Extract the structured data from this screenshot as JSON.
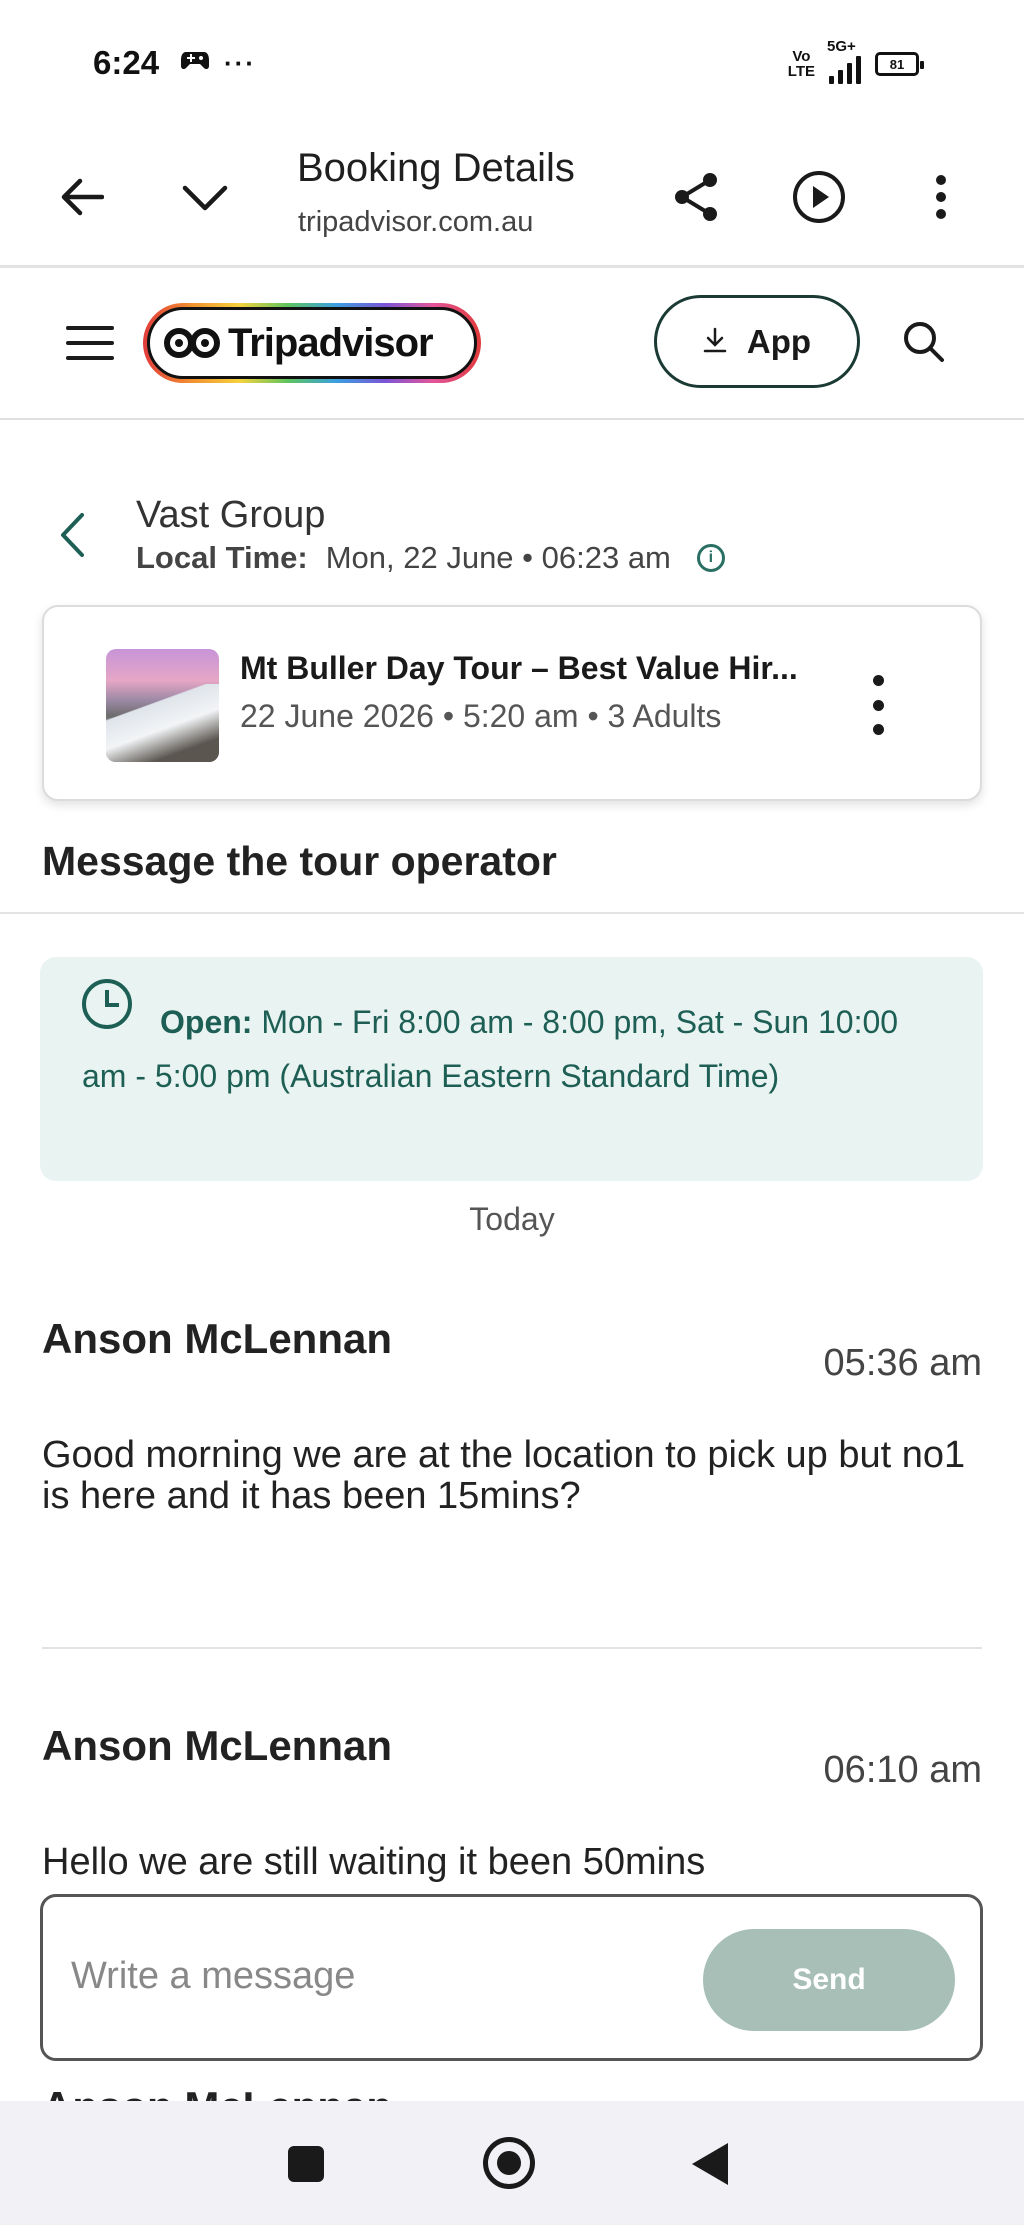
{
  "status_bar": {
    "time": "6:24",
    "more": "···",
    "network_label_top": "Vo",
    "network_label_bottom": "LTE",
    "network_type": "5G+",
    "battery": "81"
  },
  "browser": {
    "title": "Booking Details",
    "url": "tripadvisor.com.au"
  },
  "site_header": {
    "logo_text": "Tripadvisor",
    "app_button_label": "App"
  },
  "conversation": {
    "operator_name": "Vast Group",
    "local_time_label": "Local Time:",
    "local_time_value": "Mon, 22 June • 06:23 am",
    "info_glyph": "i"
  },
  "booking": {
    "title": "Mt Buller Day Tour – Best Value Hir...",
    "meta": "22 June 2026 • 5:20 am • 3 Adults"
  },
  "section_title": "Message the tour operator",
  "hours": {
    "label": "Open:",
    "text": "Mon - Fri 8:00 am - 8:00 pm, Sat - Sun 10:00 am - 5:00 pm (Australian Eastern Standard Time)"
  },
  "day_label": "Today",
  "messages": [
    {
      "sender": "Anson McLennan",
      "time": "05:36 am",
      "body": "Good morning we are at the location to pick up but no1 is here  and it has been 15mins?"
    },
    {
      "sender": "Anson McLennan",
      "time": "06:10 am",
      "body": "Hello we are still waiting it been 50mins"
    }
  ],
  "composer": {
    "placeholder": "Write a message",
    "send_label": "Send"
  },
  "peek_sender": "Anson McLennan",
  "colors": {
    "brand_green": "#1e5f55",
    "hours_bg": "#e9f3f1",
    "send_disabled": "#a8bfb8"
  }
}
